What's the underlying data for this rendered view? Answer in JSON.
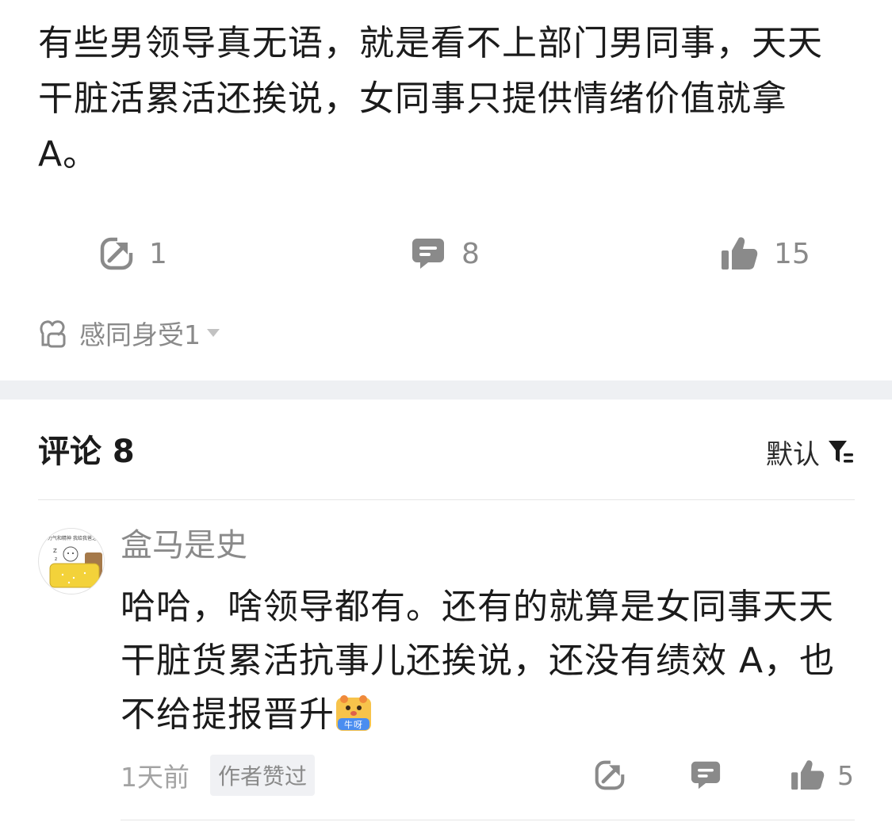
{
  "post": {
    "body": "有些男领导真无语，就是看不上部门男同事，天天干脏活累活还挨说，女同事只提供情绪价值就拿A。"
  },
  "actions": {
    "share_count": "1",
    "comment_count": "8",
    "like_count": "15"
  },
  "reaction": {
    "label": "感同身受1"
  },
  "comments_section": {
    "title": "评论 8",
    "sort_label": "默认"
  },
  "comment": {
    "author": "盒马是史",
    "text": "哈哈，啥领导都有。还有的就算是女同事天天干脏货累活抗事儿还挨说，还没有绩效 A，也不给提报晋升",
    "emoji_label": "牛呀",
    "time": "1天前",
    "badge": "作者赞过",
    "like_count": "5",
    "avatar_caption": "有力气和精神 我给我爸之后"
  },
  "colors": {
    "icon_gray": "#8a8a8a",
    "band": "#eef0f3",
    "text": "#1b1b1b"
  }
}
